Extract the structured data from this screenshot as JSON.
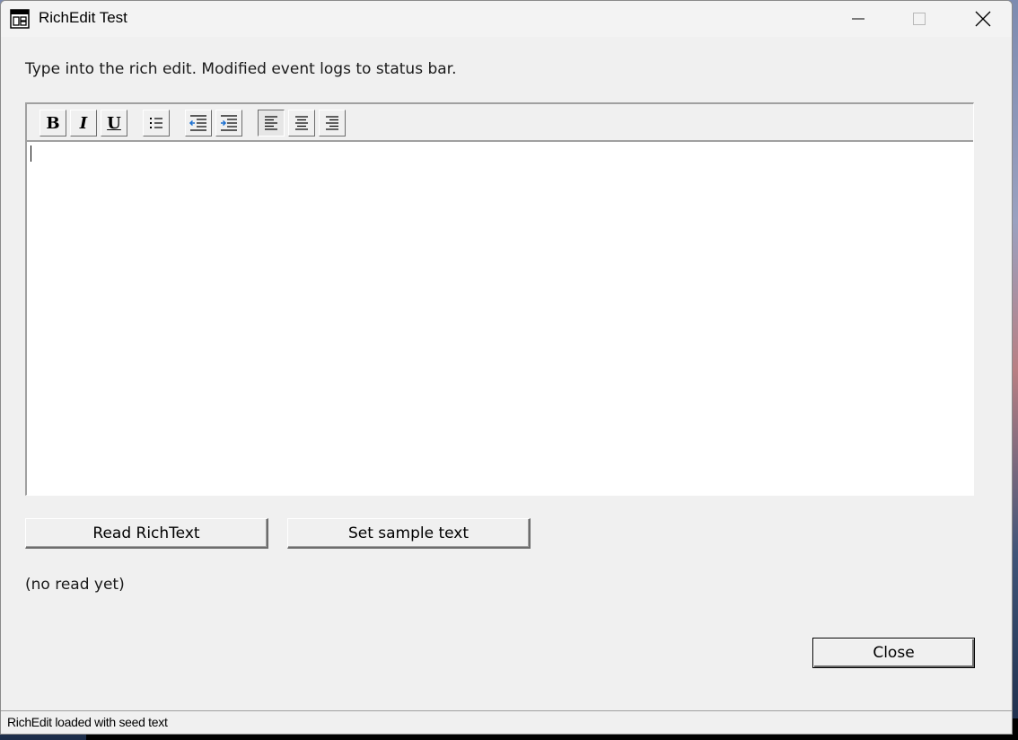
{
  "window": {
    "title": "RichEdit Test",
    "icon": "app-window-icon"
  },
  "caption_buttons": {
    "minimize": "minimize-icon",
    "maximize": "maximize-icon",
    "close": "close-icon"
  },
  "instruction": "Type into the rich edit. Modified event logs to status bar.",
  "toolbar": {
    "bold": "B",
    "italic": "I",
    "underline": "U",
    "icons": [
      "bullet-list-icon",
      "outdent-icon",
      "indent-icon",
      "align-left-icon",
      "align-center-icon",
      "align-right-icon"
    ]
  },
  "editor": {
    "content": ""
  },
  "buttons": {
    "read": "Read RichText",
    "sample": "Set sample text",
    "close": "Close"
  },
  "read_result": "(no read yet)",
  "status": {
    "text": "RichEdit loaded with seed text"
  }
}
